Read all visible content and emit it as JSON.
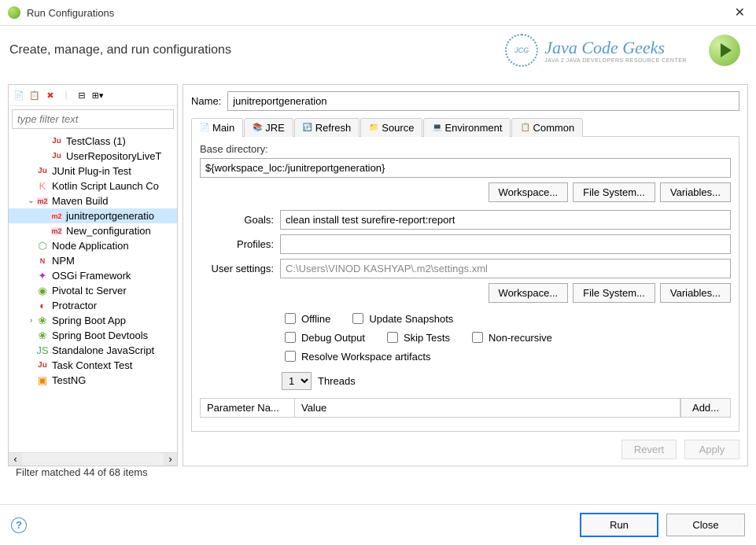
{
  "window": {
    "title": "Run Configurations",
    "headline": "Create, manage, and run configurations"
  },
  "brand": {
    "logo_initials": "JCG",
    "name": "Java Code Geeks",
    "tagline": "Java 2 Java Developers Resource Center"
  },
  "filter": {
    "placeholder": "type filter text",
    "status": "Filter matched 44 of 68 items"
  },
  "tree": [
    {
      "indent": 1,
      "icon": "ju",
      "label": "TestClass (1)"
    },
    {
      "indent": 1,
      "icon": "ju",
      "label": "UserRepositoryLiveT"
    },
    {
      "indent": 0,
      "icon": "ju-plug",
      "label": "JUnit Plug-in Test"
    },
    {
      "indent": 0,
      "icon": "kotlin",
      "label": "Kotlin Script Launch Co"
    },
    {
      "indent": 0,
      "exp": "⌄",
      "icon": "m2",
      "label": "Maven Build"
    },
    {
      "indent": 1,
      "icon": "m2",
      "label": "junitreportgeneratio",
      "selected": true
    },
    {
      "indent": 1,
      "icon": "m2",
      "label": "New_configuration"
    },
    {
      "indent": 0,
      "icon": "node",
      "label": "Node Application"
    },
    {
      "indent": 0,
      "icon": "npm",
      "label": "NPM"
    },
    {
      "indent": 0,
      "icon": "osgi",
      "label": "OSGi Framework"
    },
    {
      "indent": 0,
      "icon": "pivotal",
      "label": "Pivotal tc Server"
    },
    {
      "indent": 0,
      "icon": "protractor",
      "label": "Protractor"
    },
    {
      "indent": 0,
      "exp": "›",
      "icon": "spring",
      "label": "Spring Boot App"
    },
    {
      "indent": 0,
      "icon": "spring",
      "label": "Spring Boot Devtools"
    },
    {
      "indent": 0,
      "icon": "js",
      "label": "Standalone JavaScript"
    },
    {
      "indent": 0,
      "icon": "ju",
      "label": "Task Context Test"
    },
    {
      "indent": 0,
      "icon": "testng",
      "label": "TestNG"
    }
  ],
  "form": {
    "name_label": "Name:",
    "name_value": "junitreportgeneration",
    "tabs": [
      "Main",
      "JRE",
      "Refresh",
      "Source",
      "Environment",
      "Common"
    ],
    "base_dir_label": "Base directory:",
    "base_dir_value": "${workspace_loc:/junitreportgeneration}",
    "workspace_btn": "Workspace...",
    "filesystem_btn": "File System...",
    "variables_btn": "Variables...",
    "goals_label": "Goals:",
    "goals_value": "clean install test surefire-report:report",
    "profiles_label": "Profiles:",
    "profiles_value": "",
    "usersettings_label": "User settings:",
    "usersettings_value": "C:\\Users\\VINOD KASHYAP\\.m2\\settings.xml",
    "checks": {
      "offline": "Offline",
      "update": "Update Snapshots",
      "debug": "Debug Output",
      "skip": "Skip Tests",
      "nonrec": "Non-recursive",
      "resolve": "Resolve Workspace artifacts"
    },
    "threads_value": "1",
    "threads_label": "Threads",
    "param_name": "Parameter Na...",
    "param_value": "Value",
    "add_btn": "Add...",
    "revert": "Revert",
    "apply": "Apply"
  },
  "footer": {
    "run": "Run",
    "close": "Close"
  }
}
